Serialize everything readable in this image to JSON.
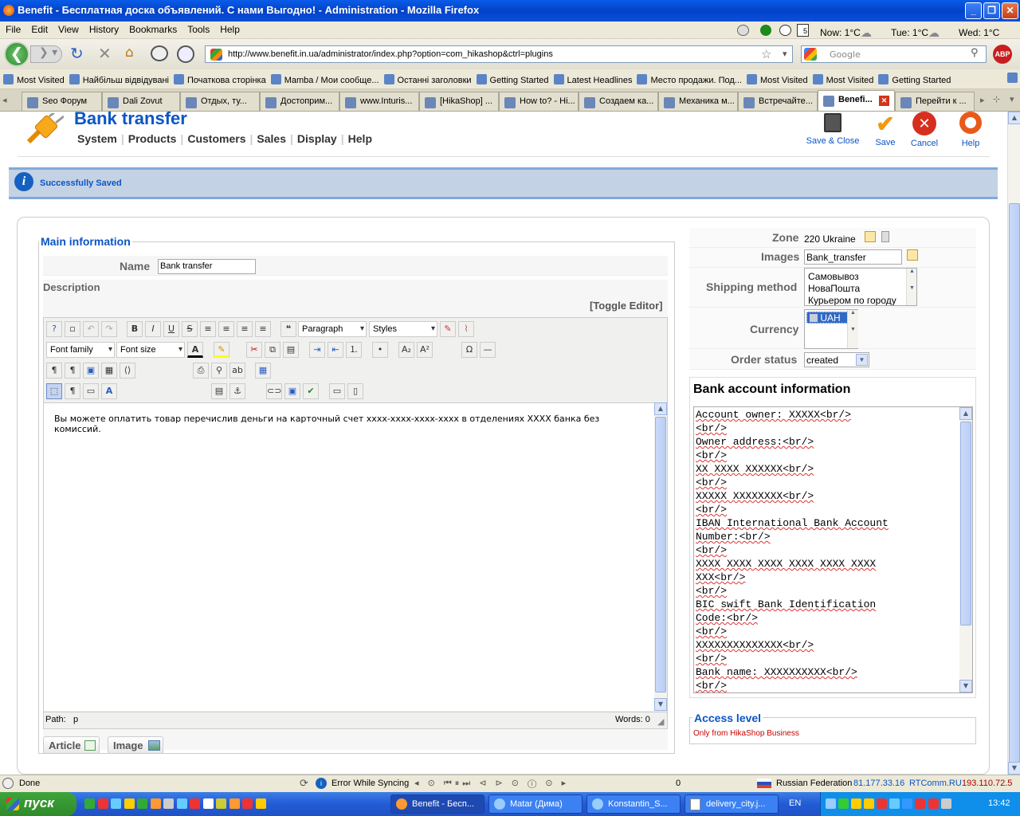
{
  "window": {
    "title": "Benefit - Бесплатная доска объявлений. С нами Выгодно! - Administration - Mozilla Firefox"
  },
  "menu": [
    "File",
    "Edit",
    "View",
    "History",
    "Bookmarks",
    "Tools",
    "Help"
  ],
  "weather": {
    "now": "Now: 1°C",
    "tue": "Tue: 1°C",
    "wed": "Wed: 1°C"
  },
  "url": "http://www.benefit.in.ua/administrator/index.php?option=com_hikashop&ctrl=plugins",
  "search_placeholder": "Google",
  "bookmarks": [
    "Most Visited",
    "Найбільш відвідувані",
    "Початкова сторінка",
    "Mamba / Мои сообще...",
    "Останні заголовки",
    "Getting Started",
    "Latest Headlines",
    "Место продажи. Под...",
    "Most Visited",
    "Most Visited",
    "Getting Started"
  ],
  "tabs": [
    "Seo Форум",
    "Dali Zovut",
    "Отдых, ту...",
    "Достоприм...",
    "www.Inturis...",
    "[HikaShop] ...",
    "How to? - Hi...",
    "Создаем ка...",
    "Механика м...",
    "Встречайте...",
    "Benefi...",
    "Перейти к ..."
  ],
  "header": {
    "title": "Bank transfer",
    "submenu": [
      "System",
      "Products",
      "Customers",
      "Sales",
      "Display",
      "Help"
    ],
    "actions": {
      "save_close": "Save & Close",
      "save": "Save",
      "cancel": "Cancel",
      "help": "Help"
    }
  },
  "message": "Successfully Saved",
  "main": {
    "legend": "Main information",
    "name_label": "Name",
    "name_value": "Bank transfer",
    "description_label": "Description",
    "toggle_editor": "[Toggle Editor]",
    "editor": {
      "paragraph": "Paragraph",
      "styles": "Styles",
      "font_family": "Font family",
      "font_size": "Font size",
      "content": "Вы можете оплатить товар перечислив деньги на карточный счет xxxx-xxxx-xxxx-xxxx в отделениях XXXX банка без комиссий.",
      "path_label": "Path:",
      "path_value": "p",
      "words": "Words: 0"
    },
    "buttons": {
      "article": "Article",
      "image": "Image"
    }
  },
  "side": {
    "zone_label": "Zone",
    "zone_value": "220 Ukraine",
    "images_label": "Images",
    "images_value": "Bank_transfer",
    "shipping_label": "Shipping method",
    "shipping_options": [
      "Самовывоз",
      "НоваПошта",
      "Курьером по городу"
    ],
    "currency_label": "Currency",
    "currency_options": [
      "UAH"
    ],
    "order_status_label": "Order status",
    "order_status_value": "created",
    "bank_title": "Bank account information",
    "bank_lines": [
      "Account owner: XXXXX<br/>",
      "<br/>",
      "Owner address:<br/>",
      "<br/>",
      "XX XXXX XXXXXX<br/>",
      "<br/>",
      "XXXXX XXXXXXXX<br/>",
      "<br/>",
      "IBAN International Bank Account",
      "Number:<br/>",
      "<br/>",
      "XXXX XXXX XXXX XXXX XXXX XXXX",
      "XXX<br/>",
      "<br/>",
      "BIC swift Bank Identification",
      "Code:<br/>",
      "<br/>",
      "XXXXXXXXXXXXXX<br/>",
      "<br/>",
      "Bank name: XXXXXXXXXX<br/>",
      "<br/>"
    ],
    "access_title": "Access level",
    "access_text": "Only from HikaShop Business"
  },
  "status": {
    "left": "Done",
    "sync": "Error While Syncing",
    "count": "0",
    "country": "Russian Federation",
    "ip": "81.177.33.16",
    "provider": "RTComm.RU",
    "ip2": "193.110.72.5"
  },
  "taskbar": {
    "start": "пуск",
    "items": [
      "Benefit - Бесп...",
      "Matar (Дима)",
      "Konstantin_S...",
      "delivery_city.j..."
    ],
    "lang": "EN",
    "time": "13:42"
  },
  "colors": {
    "accent": "#0b55c4",
    "title_blue": "#0342c9",
    "msg_bg": "#c3d2e5",
    "cancel_red": "#d62f1f",
    "save_orange": "#f39a0b"
  }
}
